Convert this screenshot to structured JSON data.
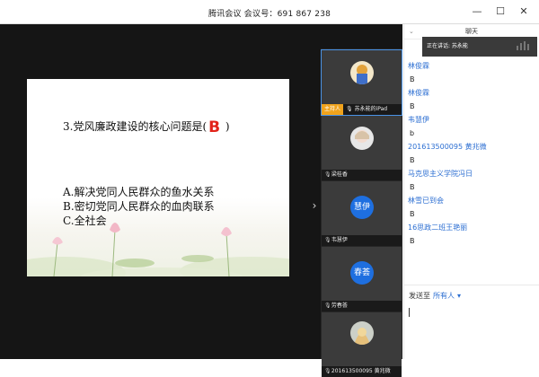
{
  "window": {
    "title": "腾讯会议 会议号：691 867 238"
  },
  "slide": {
    "question": "3.党风廉政建设的核心问题是(",
    "question_close": " )",
    "answer": "B",
    "options": [
      "A.解决党同人民群众的鱼水关系",
      "B.密切党同人民群众的血肉联系",
      "C.全社会"
    ]
  },
  "participants": [
    {
      "host_badge": "主持人",
      "name": "苏永能的iPad",
      "type": "photo"
    },
    {
      "name": "梁桂香",
      "type": "photo"
    },
    {
      "avatar_text": "慧伊",
      "name": "韦慧伊",
      "type": "avatar"
    },
    {
      "avatar_text": "春荟",
      "name": "劳春荟",
      "type": "avatar"
    },
    {
      "name": "201613500095 黄兆微",
      "type": "photo"
    }
  ],
  "chat": {
    "header": "聊天",
    "speaking": "正在讲话: 苏永能",
    "messages": [
      {
        "sender": "林俊霖",
        "text": "B"
      },
      {
        "sender": "林俊霖",
        "text": "B"
      },
      {
        "sender": "韦慧伊",
        "text": "b"
      },
      {
        "sender": "201613500095 黄兆微",
        "text": "B"
      },
      {
        "sender": "马克思主义学院冯日",
        "text": "B"
      },
      {
        "sender": "林雪已到会",
        "text": "B"
      },
      {
        "sender": "16思政二班王艳丽",
        "text": "B"
      }
    ],
    "send_to_label": "发送至",
    "send_to_target": "所有人",
    "send_to_caret": "▾"
  },
  "colors": {
    "accent": "#2b6ed2",
    "answer": "#e2231a",
    "host_badge": "#f0a31c",
    "avatar_bg": "#1e6fe0"
  }
}
